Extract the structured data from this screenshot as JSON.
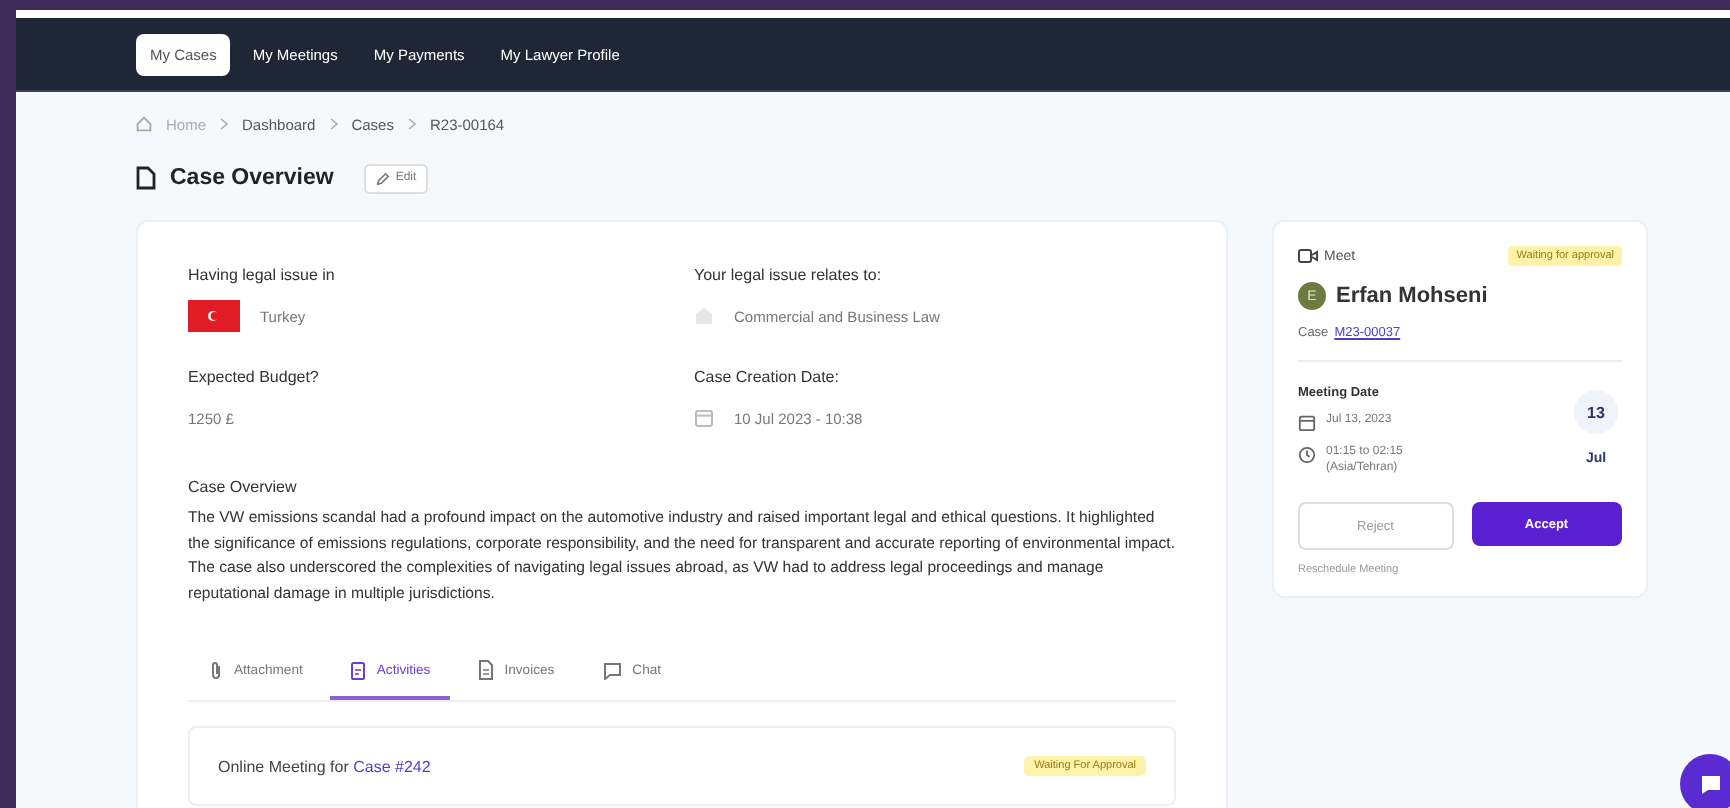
{
  "nav_tabs": [
    {
      "label": "My Cases",
      "selected": true
    },
    {
      "label": "My Meetings",
      "selected": false
    },
    {
      "label": "My Payments",
      "selected": false
    },
    {
      "label": "My Lawyer Profile",
      "selected": false
    }
  ],
  "breadcrumb": [
    {
      "label": "Home",
      "kind": "home"
    },
    {
      "label": "Dashboard",
      "kind": "link"
    },
    {
      "label": "Cases",
      "kind": "link"
    },
    {
      "label": "R23-00164",
      "kind": "current"
    }
  ],
  "page_title": "Case Overview",
  "edit_button": "Edit",
  "case_fields": [
    {
      "label": "Having legal issue in",
      "value": "Turkey",
      "kind": "country"
    },
    {
      "label": "Your legal issue relates to:",
      "value": "Commercial and Business Law",
      "kind": "category"
    },
    {
      "label": "Expected Budget?",
      "value": "1250 £",
      "kind": "plain"
    },
    {
      "label": "Case Creation Date:",
      "value": "10 Jul 2023 - 10:38",
      "kind": "date"
    }
  ],
  "overview": {
    "heading": "Case Overview",
    "text": "The VW emissions scandal had a profound impact on the automotive industry and raised important legal and ethical questions. It highlighted the significance of emissions regulations, corporate responsibility, and the need for transparent and accurate reporting of environmental impact. The case also underscored the complexities of navigating legal issues abroad, as VW had to address legal proceedings and manage reputational damage in multiple jurisdictions."
  },
  "detail_tabs": [
    {
      "label": "Attachment",
      "kind": "clip",
      "selected": false
    },
    {
      "label": "Activities",
      "kind": "clipboard",
      "selected": true
    },
    {
      "label": "Invoices",
      "kind": "doc",
      "selected": false
    },
    {
      "label": "Chat",
      "kind": "chat",
      "selected": false
    }
  ],
  "activity": {
    "text": "Online Meeting for",
    "link": "Case #242",
    "badge": "Waiting For Approval"
  },
  "meeting": {
    "type": "Meet",
    "status": "Waiting for approval",
    "avatar_initial": "E",
    "name": "Erfan Mohseni",
    "case_label": "Case",
    "case_link": "M23-00037",
    "date_heading": "Meeting Date",
    "date": "Jul 13, 2023",
    "time": "01:15 to 02:15",
    "timezone": "(Asia/Tehran)",
    "day": "13",
    "month": "Jul",
    "reject": "Reject",
    "accept": "Accept",
    "reschedule": "Reschedule Meeting"
  }
}
